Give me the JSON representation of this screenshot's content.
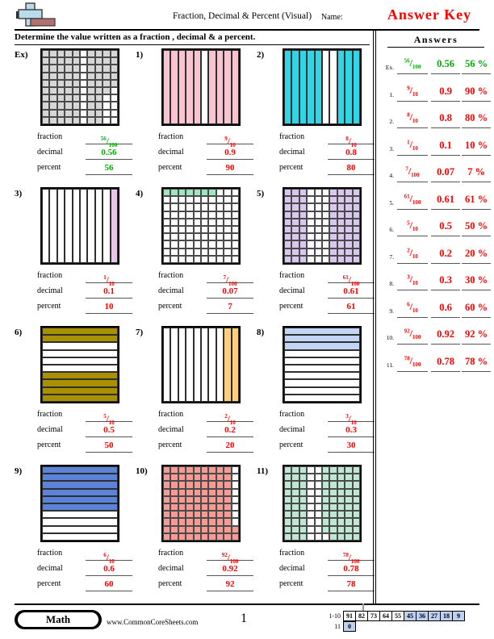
{
  "header": {
    "title": "Fraction, Decimal & Percent (Visual)",
    "name_label": "Name:",
    "answer_key": "Answer Key",
    "logo_icon": "plus-block-logo"
  },
  "instructions": "Determine the value written as a fraction , decimal & a percent.",
  "answers_panel": {
    "title": "Answers",
    "rows": [
      {
        "num": "Ex.",
        "numerator": "56",
        "denominator": "100",
        "decimal": "0.56",
        "percent": "56 %",
        "color": "green"
      },
      {
        "num": "1.",
        "numerator": "9",
        "denominator": "10",
        "decimal": "0.9",
        "percent": "90 %",
        "color": "red"
      },
      {
        "num": "2.",
        "numerator": "8",
        "denominator": "10",
        "decimal": "0.8",
        "percent": "80 %",
        "color": "red"
      },
      {
        "num": "3.",
        "numerator": "1",
        "denominator": "10",
        "decimal": "0.1",
        "percent": "10 %",
        "color": "red"
      },
      {
        "num": "4.",
        "numerator": "7",
        "denominator": "100",
        "decimal": "0.07",
        "percent": "7 %",
        "color": "red"
      },
      {
        "num": "5.",
        "numerator": "61",
        "denominator": "100",
        "decimal": "0.61",
        "percent": "61 %",
        "color": "red"
      },
      {
        "num": "6.",
        "numerator": "5",
        "denominator": "10",
        "decimal": "0.5",
        "percent": "50 %",
        "color": "red"
      },
      {
        "num": "7.",
        "numerator": "2",
        "denominator": "10",
        "decimal": "0.2",
        "percent": "20 %",
        "color": "red"
      },
      {
        "num": "8.",
        "numerator": "3",
        "denominator": "10",
        "decimal": "0.3",
        "percent": "30 %",
        "color": "red"
      },
      {
        "num": "9.",
        "numerator": "6",
        "denominator": "10",
        "decimal": "0.6",
        "percent": "60 %",
        "color": "red"
      },
      {
        "num": "10.",
        "numerator": "92",
        "denominator": "100",
        "decimal": "0.92",
        "percent": "92 %",
        "color": "red"
      },
      {
        "num": "11.",
        "numerator": "78",
        "denominator": "100",
        "decimal": "0.78",
        "percent": "78 %",
        "color": "red"
      }
    ]
  },
  "row_labels": {
    "fraction": "fraction",
    "decimal": "decimal",
    "percent": "percent"
  },
  "problems": [
    {
      "num": "Ex)",
      "color": "green",
      "fill": "#d6d6d6",
      "grid": "cells10x10",
      "shaded_count": 56,
      "shaded_cells": [
        1,
        2,
        3,
        4,
        5,
        7,
        8,
        9,
        10,
        11,
        12,
        13,
        14,
        15,
        17,
        18,
        19,
        20,
        21,
        22,
        23,
        24,
        25,
        27,
        28,
        29,
        30,
        31,
        32,
        33,
        34,
        35,
        37,
        38,
        39,
        40,
        41,
        42,
        43,
        44,
        45,
        47,
        48,
        49,
        50,
        51,
        52,
        53,
        54,
        55,
        57,
        58,
        59,
        61,
        62,
        63,
        64,
        65,
        67,
        68,
        71,
        72,
        73,
        74,
        75,
        77,
        78,
        81,
        82,
        83,
        84,
        85,
        87,
        88,
        91,
        92,
        93,
        94,
        95,
        97,
        98
      ],
      "numerator": "56",
      "denominator": "100",
      "decimal": "0.56",
      "percent": "56"
    },
    {
      "num": "1)",
      "color": "red",
      "fill": "#f9c4cf",
      "grid": "columns10",
      "shaded_count": 9,
      "shaded_cols": [
        1,
        2,
        3,
        4,
        5,
        7,
        8,
        9,
        10
      ],
      "numerator": "9",
      "denominator": "10",
      "decimal": "0.9",
      "percent": "90"
    },
    {
      "num": "2)",
      "color": "red",
      "fill": "#2fd6e8",
      "grid": "columns10",
      "shaded_count": 8,
      "shaded_cols": [
        1,
        2,
        3,
        4,
        5,
        8,
        9,
        10
      ],
      "numerator": "8",
      "denominator": "10",
      "decimal": "0.8",
      "percent": "80"
    },
    {
      "num": "3)",
      "color": "red",
      "fill": "#e7c6ea",
      "grid": "columns10",
      "shaded_count": 1,
      "shaded_cols": [
        10
      ],
      "numerator": "1",
      "denominator": "10",
      "decimal": "0.1",
      "percent": "10"
    },
    {
      "num": "4)",
      "color": "red",
      "fill": "#9fe5c0",
      "grid": "cells10x10",
      "shaded_count": 7,
      "shaded_cells": [
        1,
        2,
        3,
        4,
        5,
        6,
        7
      ],
      "numerator": "7",
      "denominator": "100",
      "decimal": "0.07",
      "percent": "7"
    },
    {
      "num": "5)",
      "color": "red",
      "fill": "#d8c8ef",
      "grid": "cells10x10",
      "shaded_count": 61,
      "shaded_cells": [
        1,
        2,
        3,
        7,
        8,
        9,
        10,
        11,
        12,
        13,
        17,
        18,
        19,
        20,
        21,
        22,
        23,
        27,
        28,
        29,
        30,
        31,
        32,
        33,
        37,
        38,
        39,
        40,
        41,
        42,
        43,
        47,
        48,
        49,
        50,
        51,
        52,
        53,
        57,
        58,
        59,
        60,
        61,
        62,
        63,
        67,
        68,
        69,
        70,
        71,
        72,
        73,
        77,
        78,
        79,
        80,
        81,
        82,
        83,
        87,
        88,
        89,
        90,
        91,
        92,
        93,
        97,
        98,
        99,
        100
      ],
      "numerator": "61",
      "denominator": "100",
      "decimal": "0.61",
      "percent": "61"
    },
    {
      "num": "6)",
      "color": "red",
      "fill": "#a89000",
      "grid": "rows10",
      "shaded_count": 5,
      "shaded_rows": [
        1,
        2,
        7,
        8,
        9,
        10
      ],
      "numerator": "5",
      "denominator": "10",
      "decimal": "0.5",
      "percent": "50"
    },
    {
      "num": "7)",
      "color": "red",
      "fill": "#fcce7e",
      "grid": "columns10",
      "shaded_count": 2,
      "shaded_cols": [
        9,
        10
      ],
      "numerator": "2",
      "denominator": "10",
      "decimal": "0.2",
      "percent": "20"
    },
    {
      "num": "8)",
      "color": "red",
      "fill": "#c3d5f5",
      "grid": "rows10",
      "shaded_count": 3,
      "shaded_rows": [
        1,
        2,
        3
      ],
      "numerator": "3",
      "denominator": "10",
      "decimal": "0.3",
      "percent": "30"
    },
    {
      "num": "9)",
      "color": "red",
      "fill": "#5b84d8",
      "grid": "rows10",
      "shaded_count": 6,
      "shaded_rows": [
        1,
        2,
        3,
        4,
        5,
        6
      ],
      "numerator": "6",
      "denominator": "10",
      "decimal": "0.6",
      "percent": "60"
    },
    {
      "num": "10)",
      "color": "red",
      "fill": "#f79a93",
      "grid": "cells10x10",
      "shaded_count": 92,
      "shaded_cells": [
        1,
        2,
        3,
        4,
        5,
        6,
        7,
        8,
        9,
        11,
        12,
        13,
        14,
        15,
        16,
        17,
        18,
        19,
        21,
        22,
        23,
        24,
        25,
        26,
        27,
        28,
        29,
        31,
        32,
        33,
        34,
        35,
        36,
        37,
        38,
        39,
        41,
        42,
        43,
        44,
        45,
        46,
        47,
        48,
        49,
        51,
        52,
        53,
        54,
        55,
        56,
        57,
        58,
        59,
        61,
        62,
        63,
        64,
        65,
        66,
        67,
        68,
        69,
        71,
        72,
        73,
        74,
        75,
        76,
        77,
        78,
        79,
        81,
        82,
        83,
        84,
        85,
        86,
        87,
        88,
        89,
        90,
        91,
        92,
        93,
        94,
        95,
        96,
        97,
        98,
        99,
        100
      ],
      "numerator": "92",
      "denominator": "100",
      "decimal": "0.92",
      "percent": "92"
    },
    {
      "num": "11)",
      "color": "red",
      "fill": "#bfe8d4",
      "grid": "cells10x10",
      "shaded_count": 78,
      "shaded_cells": [
        1,
        2,
        3,
        6,
        7,
        8,
        9,
        10,
        11,
        12,
        13,
        16,
        17,
        18,
        19,
        20,
        21,
        22,
        23,
        26,
        27,
        28,
        29,
        30,
        31,
        32,
        33,
        36,
        37,
        38,
        39,
        40,
        41,
        42,
        43,
        46,
        47,
        48,
        49,
        50,
        51,
        52,
        53,
        56,
        57,
        58,
        59,
        60,
        61,
        62,
        63,
        66,
        67,
        68,
        69,
        70,
        71,
        72,
        73,
        76,
        77,
        78,
        79,
        80,
        81,
        82,
        83,
        86,
        87,
        88,
        89,
        90,
        91,
        92,
        93,
        97,
        98,
        99,
        100
      ],
      "numerator": "78",
      "denominator": "100",
      "decimal": "0.78",
      "percent": "78"
    }
  ],
  "footer": {
    "math_badge": "Math",
    "site_url": "www.CommonCoreSheets.com",
    "page_number": "1",
    "score_table": {
      "row1_label": "1-10",
      "row1_values": [
        "91",
        "82",
        "73",
        "64",
        "55",
        "45",
        "36",
        "27",
        "18",
        "9"
      ],
      "row1_highlighted": [
        false,
        false,
        false,
        false,
        false,
        true,
        true,
        true,
        true,
        true
      ],
      "row2_label": "11",
      "row2_values": [
        "0"
      ],
      "row2_highlighted": [
        true
      ]
    }
  }
}
